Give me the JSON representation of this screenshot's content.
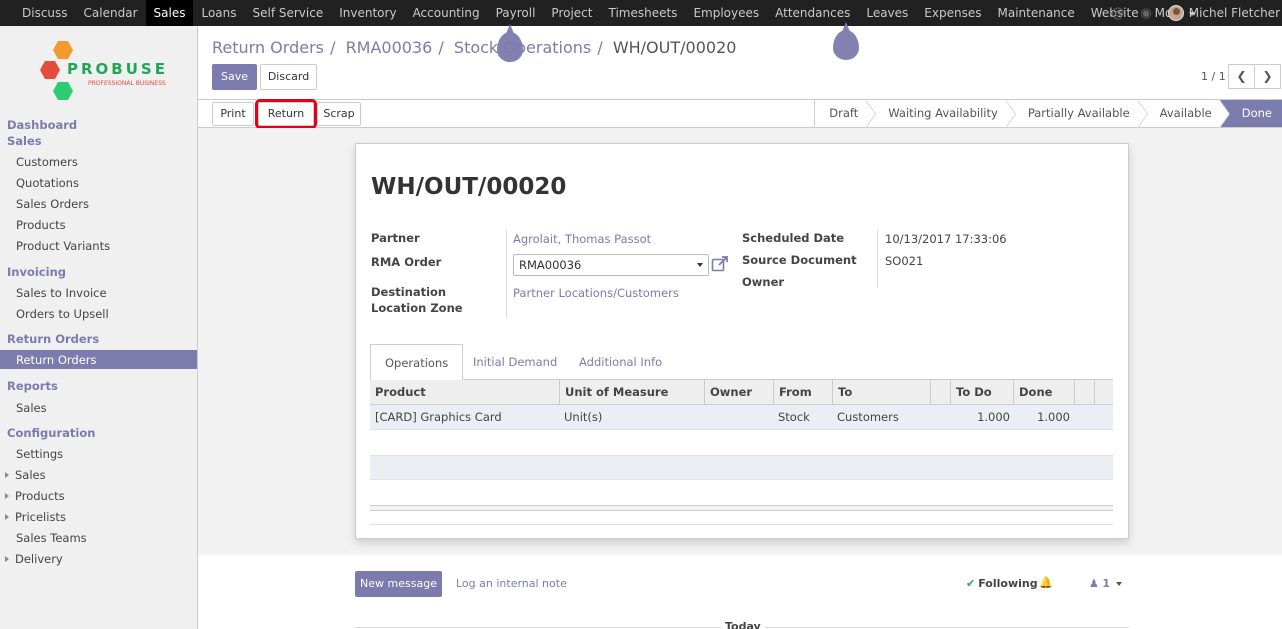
{
  "nav": {
    "items": [
      "Discuss",
      "Calendar",
      "Sales",
      "Loans",
      "Self Service",
      "Inventory",
      "Accounting",
      "Payroll",
      "Project",
      "Timesheets",
      "Employees",
      "Attendances",
      "Leaves",
      "Expenses",
      "Maintenance",
      "Website",
      "More"
    ],
    "active": "Sales",
    "user_name": "Michel Fletcher"
  },
  "logo": {
    "brand": "PROBUSE",
    "tagline": "PROFESSIONAL BUSINESS"
  },
  "sidebar": {
    "sections": [
      {
        "title": "Dashboard",
        "items": []
      },
      {
        "title": "Sales",
        "items": [
          "Customers",
          "Quotations",
          "Sales Orders",
          "Products",
          "Product Variants"
        ]
      },
      {
        "title": "Invoicing",
        "items": [
          "Sales to Invoice",
          "Orders to Upsell"
        ]
      },
      {
        "title": "Return Orders",
        "items": [
          "Return Orders"
        ]
      },
      {
        "title": "Reports",
        "items": [
          "Sales"
        ]
      },
      {
        "title": "Configuration",
        "items": [
          "Settings",
          "Sales",
          "Products",
          "Pricelists",
          "Sales Teams",
          "Delivery"
        ]
      }
    ],
    "selected": "Return Orders"
  },
  "breadcrumb": {
    "parts": [
      "Return Orders",
      "RMA00036",
      "Stock Operations"
    ],
    "current": "WH/OUT/00020"
  },
  "buttons": {
    "save": "Save",
    "discard": "Discard",
    "print": "Print",
    "return": "Return",
    "scrap": "Scrap"
  },
  "pager": {
    "text": "1 / 1"
  },
  "stages": [
    "Draft",
    "Waiting Availability",
    "Partially Available",
    "Available",
    "Done"
  ],
  "current_stage": "Done",
  "form": {
    "title": "WH/OUT/00020",
    "partner_label": "Partner",
    "partner": "Agrolait, Thomas Passot",
    "rma_label": "RMA Order",
    "rma": "RMA00036",
    "dest_label": "Destination Location Zone",
    "dest": "Partner Locations/Customers",
    "scheduled_label": "Scheduled Date",
    "scheduled": "10/13/2017 17:33:06",
    "source_label": "Source Document",
    "source": "SO021",
    "owner_label": "Owner"
  },
  "tabs": [
    "Operations",
    "Initial Demand",
    "Additional Info"
  ],
  "table": {
    "columns": [
      "Product",
      "Unit of Measure",
      "Owner",
      "From",
      "To",
      "To Do",
      "Done"
    ],
    "rows": [
      {
        "product": "[CARD] Graphics Card",
        "uom": "Unit(s)",
        "owner": "",
        "from": "Stock",
        "to": "Customers",
        "todo": "1.000",
        "done": "1.000"
      }
    ]
  },
  "chatter": {
    "new_message": "New message",
    "log_note": "Log an internal note",
    "following": "Following",
    "followers_count": "1",
    "today": "Today"
  },
  "colors": {
    "primary": "#7c7bad",
    "topbar": "#212121",
    "highlight": "#e3001b"
  }
}
